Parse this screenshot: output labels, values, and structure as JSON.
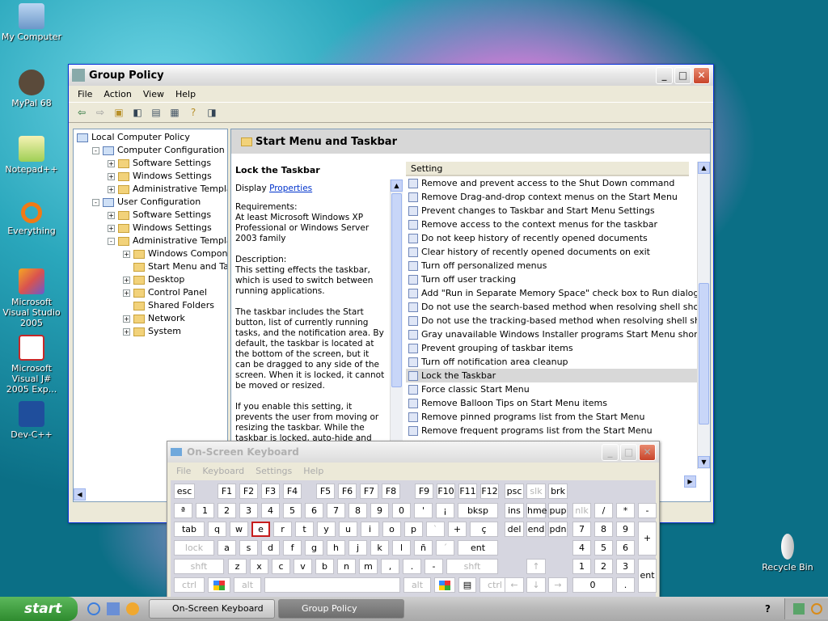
{
  "desktop": {
    "icons": [
      "My Computer",
      "MyPal 68",
      "Notepad++",
      "Everything",
      "Microsoft Visual Studio 2005",
      "Microsoft Visual J# 2005 Exp...",
      "Dev-C++"
    ],
    "recycle_bin": "Recycle Bin"
  },
  "gp": {
    "title": "Group Policy",
    "menu": [
      "File",
      "Action",
      "View",
      "Help"
    ],
    "tree": [
      {
        "label": "Local Computer Policy",
        "level": 0
      },
      {
        "label": "Computer Configuration",
        "level": 1,
        "exp": "-"
      },
      {
        "label": "Software Settings",
        "level": 2,
        "exp": "+"
      },
      {
        "label": "Windows Settings",
        "level": 2,
        "exp": "+"
      },
      {
        "label": "Administrative Templates",
        "level": 2,
        "exp": "+"
      },
      {
        "label": "User Configuration",
        "level": 1,
        "exp": "-"
      },
      {
        "label": "Software Settings",
        "level": 2,
        "exp": "+"
      },
      {
        "label": "Windows Settings",
        "level": 2,
        "exp": "+"
      },
      {
        "label": "Administrative Templates",
        "level": 2,
        "exp": "-"
      },
      {
        "label": "Windows Components",
        "level": 3,
        "exp": "+"
      },
      {
        "label": "Start Menu and Taskbar",
        "level": 3,
        "exp": ""
      },
      {
        "label": "Desktop",
        "level": 3,
        "exp": "+"
      },
      {
        "label": "Control Panel",
        "level": 3,
        "exp": "+"
      },
      {
        "label": "Shared Folders",
        "level": 3,
        "exp": ""
      },
      {
        "label": "Network",
        "level": 3,
        "exp": "+"
      },
      {
        "label": "System",
        "level": 3,
        "exp": "+"
      }
    ],
    "pane_header": "Start Menu and Taskbar",
    "desc": {
      "title": "Lock the Taskbar",
      "display": "Display",
      "link": "Properties",
      "requirements_label": "Requirements:",
      "requirements": "At least Microsoft Windows XP Professional or Windows Server 2003 family",
      "description_label": "Description:",
      "p1": "This setting effects the taskbar, which is used to switch between running applications.",
      "p2": "The taskbar includes the Start button, list of currently running tasks, and the notification area. By default, the taskbar is located at the bottom of the screen, but it can be dragged to any side of the screen. When it is locked, it cannot be moved or resized.",
      "p3": "If you enable this setting, it prevents the user from moving or resizing the taskbar. While the taskbar is locked, auto-hide and other taskbar options"
    },
    "column_header": "Setting",
    "settings": [
      "Remove and prevent access to the Shut Down command",
      "Remove Drag-and-drop context menus on the Start Menu",
      "Prevent changes to Taskbar and Start Menu Settings",
      "Remove access to the context menus for the taskbar",
      "Do not keep history of recently opened documents",
      "Clear history of recently opened documents on exit",
      "Turn off personalized menus",
      "Turn off user tracking",
      "Add \"Run in Separate Memory Space\" check box to Run dialog box",
      "Do not use the search-based method when resolving shell shortcuts",
      "Do not use the tracking-based method when resolving shell short...",
      "Gray unavailable Windows Installer programs Start Menu shortcuts",
      "Prevent grouping of taskbar items",
      "Turn off notification area cleanup",
      "Lock the Taskbar",
      "Force classic Start Menu",
      "Remove Balloon Tips on Start Menu items",
      "Remove pinned programs list from the Start Menu",
      "Remove frequent programs list from the Start Menu"
    ],
    "selected_setting": "Lock the Taskbar"
  },
  "osk": {
    "title": "On-Screen Keyboard",
    "menu": [
      "File",
      "Keyboard",
      "Settings",
      "Help"
    ],
    "highlighted_key": "e"
  },
  "taskbar": {
    "start": "start",
    "tasks": [
      "On-Screen Keyboard",
      "Group Policy"
    ],
    "active_task": "Group Policy"
  }
}
